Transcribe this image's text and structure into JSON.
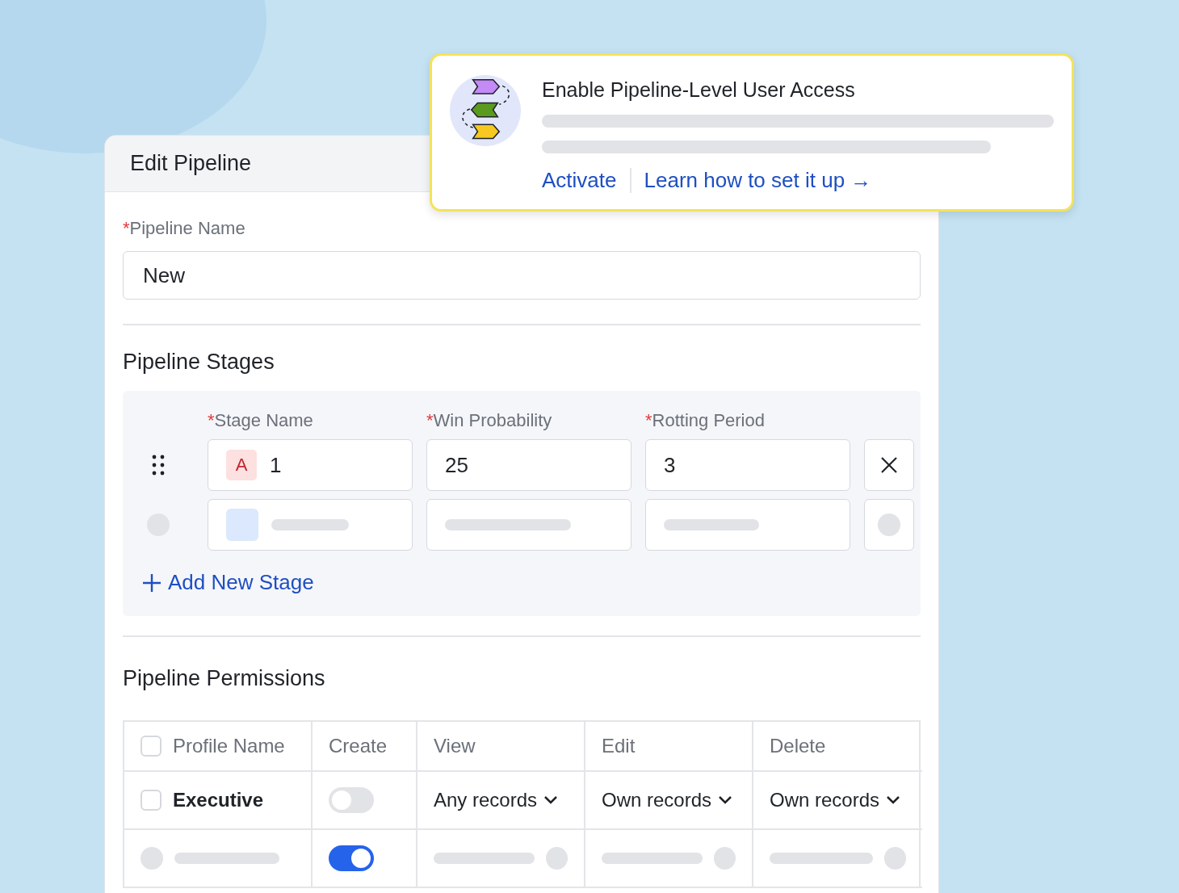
{
  "popup": {
    "title": "Enable Pipeline-Level User Access",
    "actions": [
      {
        "label": "Activate"
      },
      {
        "label": "Learn how to set it up →"
      }
    ]
  },
  "panel": {
    "title": "Edit Pipeline"
  },
  "pipeline_name": {
    "mark": "*",
    "label": "Pipeline Name",
    "value": "New"
  },
  "stages": {
    "title": "Pipeline Stages",
    "columns": [
      {
        "mark": "*",
        "label": "Stage Name"
      },
      {
        "mark": "*",
        "label": "Win Probability"
      },
      {
        "mark": "*",
        "label": "Rotting Period"
      }
    ],
    "rows": [
      {
        "kind": "stage",
        "badge": "A",
        "name": "1",
        "win_probability": "25",
        "rotting_period": "3"
      },
      {
        "kind": "placeholder"
      }
    ],
    "add_label": "Add New Stage"
  },
  "permissions": {
    "title": "Pipeline Permissions",
    "header_checked": false,
    "columns": [
      "Profile Name",
      "Create",
      "View",
      "Edit",
      "Delete"
    ],
    "rows": [
      {
        "kind": "profile",
        "name": "Executive",
        "checked": false,
        "create_on": false,
        "view": "Any records",
        "edit": "Own records",
        "delete": "Own records"
      },
      {
        "kind": "placeholder",
        "create_on": true
      }
    ]
  }
}
